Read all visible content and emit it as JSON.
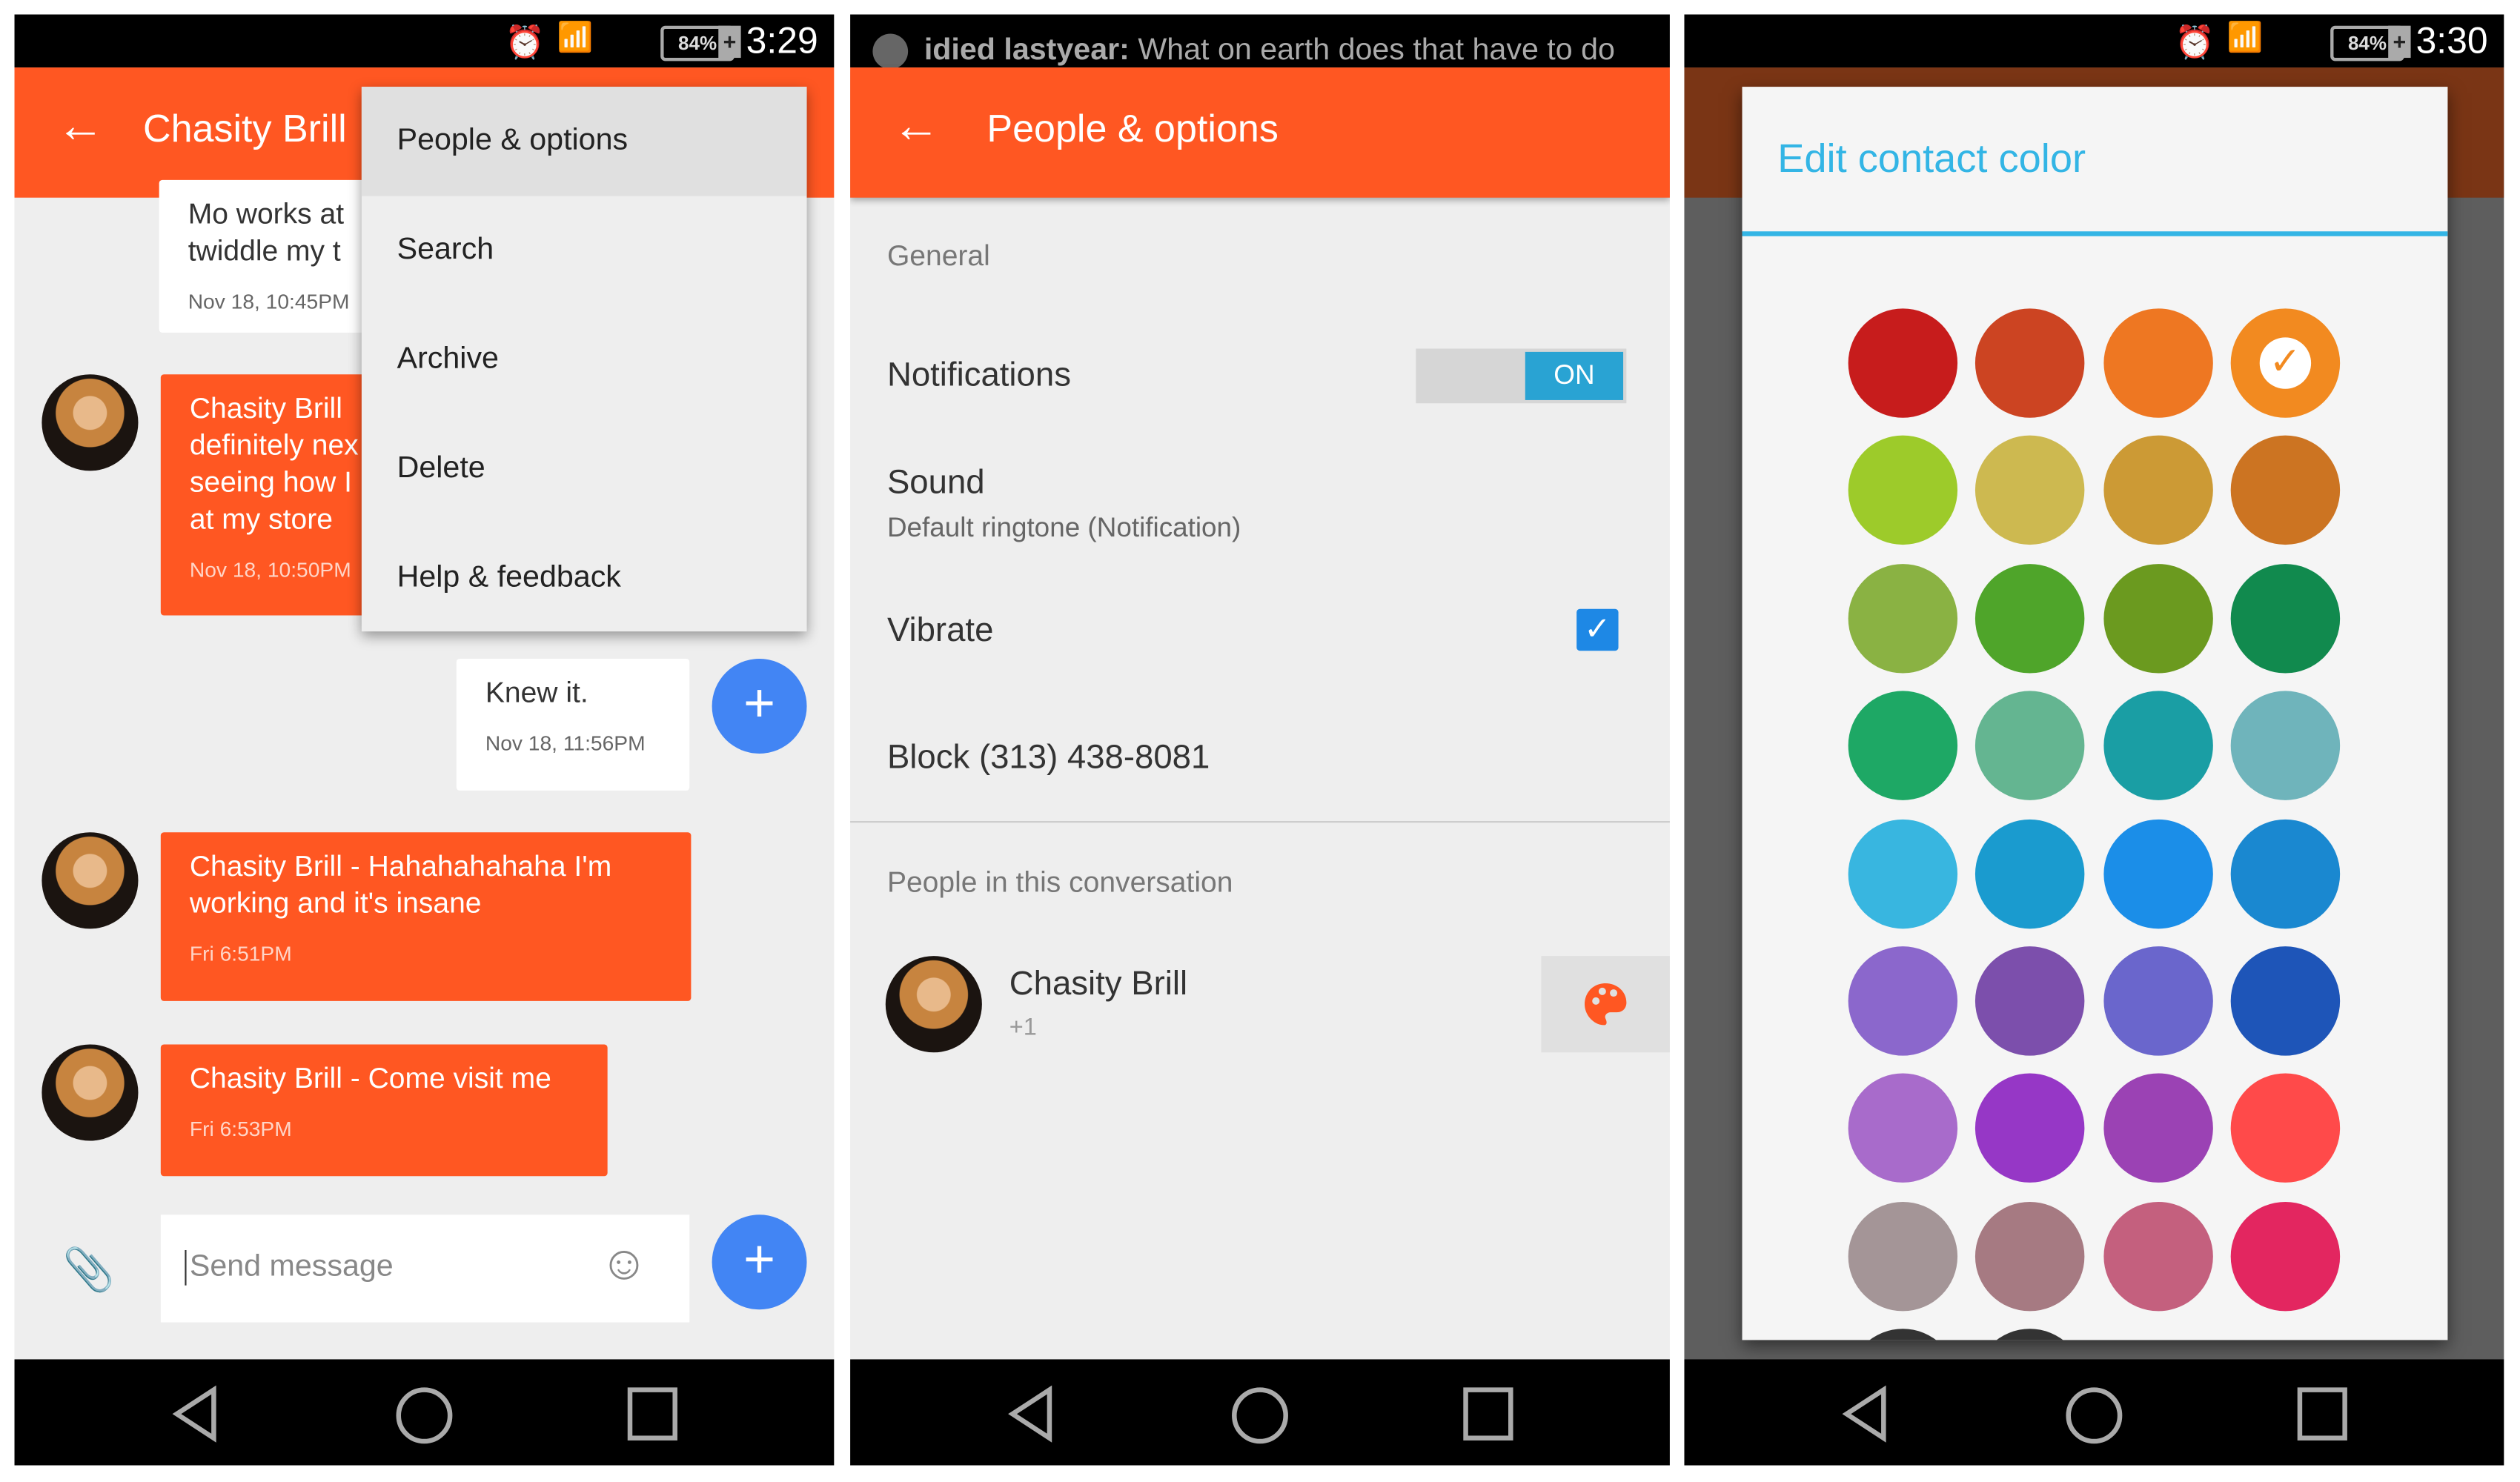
{
  "panel1": {
    "status": {
      "time": "3:29",
      "battery": "84%"
    },
    "appbar": {
      "title": "Chasity Brill"
    },
    "menu": {
      "items": [
        {
          "label": "People & options",
          "highlighted": true
        },
        {
          "label": "Search"
        },
        {
          "label": "Archive"
        },
        {
          "label": "Delete"
        },
        {
          "label": "Help & feedback"
        }
      ]
    },
    "messages": [
      {
        "direction": "out",
        "lines": [
          "Mo works at",
          "twiddle my t"
        ],
        "time": "Nov 18, 10:45PM"
      },
      {
        "direction": "in",
        "lines": [
          "Chasity Brill",
          "definitely nex",
          "seeing how I",
          "at my store"
        ],
        "time": "Nov 18, 10:50PM"
      },
      {
        "direction": "out",
        "lines": [
          "Knew it."
        ],
        "time": "Nov 18, 11:56PM"
      },
      {
        "direction": "in",
        "lines": [
          "Chasity Brill - Hahahahahaha I'm",
          "working and it's insane"
        ],
        "time": "Fri 6:51PM"
      },
      {
        "direction": "in",
        "lines": [
          "Chasity Brill - Come visit me"
        ],
        "time": "Fri 6:53PM"
      }
    ],
    "composer": {
      "placeholder": "Send message"
    }
  },
  "panel2": {
    "ticker": {
      "sender": "idied lastyear:",
      "text": "What on earth does that have to do"
    },
    "appbar": {
      "title": "People & options"
    },
    "general_header": "General",
    "notifications": {
      "label": "Notifications",
      "toggle": "ON",
      "on": true
    },
    "sound": {
      "label": "Sound",
      "value": "Default ringtone (Notification)"
    },
    "vibrate": {
      "label": "Vibrate",
      "checked": true
    },
    "block": {
      "label": "Block (313) 438-8081"
    },
    "people_header": "People in this conversation",
    "contact": {
      "name": "Chasity Brill",
      "subtitle": "+1"
    }
  },
  "panel3": {
    "status": {
      "time": "3:30",
      "battery": "84%"
    },
    "dialog": {
      "title": "Edit contact color",
      "accent": "#33b5e5",
      "selected": "#f28a20",
      "colors": [
        "#c71c1c",
        "#cc4422",
        "#ee7722",
        "#f28a20",
        "#9dcb2a",
        "#cdb950",
        "#cc9a35",
        "#cc7422",
        "#8ab243",
        "#4fa52a",
        "#6b9a1f",
        "#118a4e",
        "#1ea865",
        "#64b591",
        "#1a9ea4",
        "#6fb4bb",
        "#38b6e0",
        "#1a9bcf",
        "#1b8ee8",
        "#1a88d0",
        "#8b67cc",
        "#7c4fac",
        "#6a66cc",
        "#1e55b8",
        "#a86bcb",
        "#9637c6",
        "#9b42b4",
        "#ff4a4a",
        "#a49597",
        "#a67a82",
        "#c4607e",
        "#e32660",
        "#333333",
        "#333333"
      ]
    }
  },
  "colors": {
    "brand": "#ff5722",
    "fab": "#4285f4",
    "toggle_on": "#29a3d3",
    "checkbox": "#1e88e5"
  }
}
